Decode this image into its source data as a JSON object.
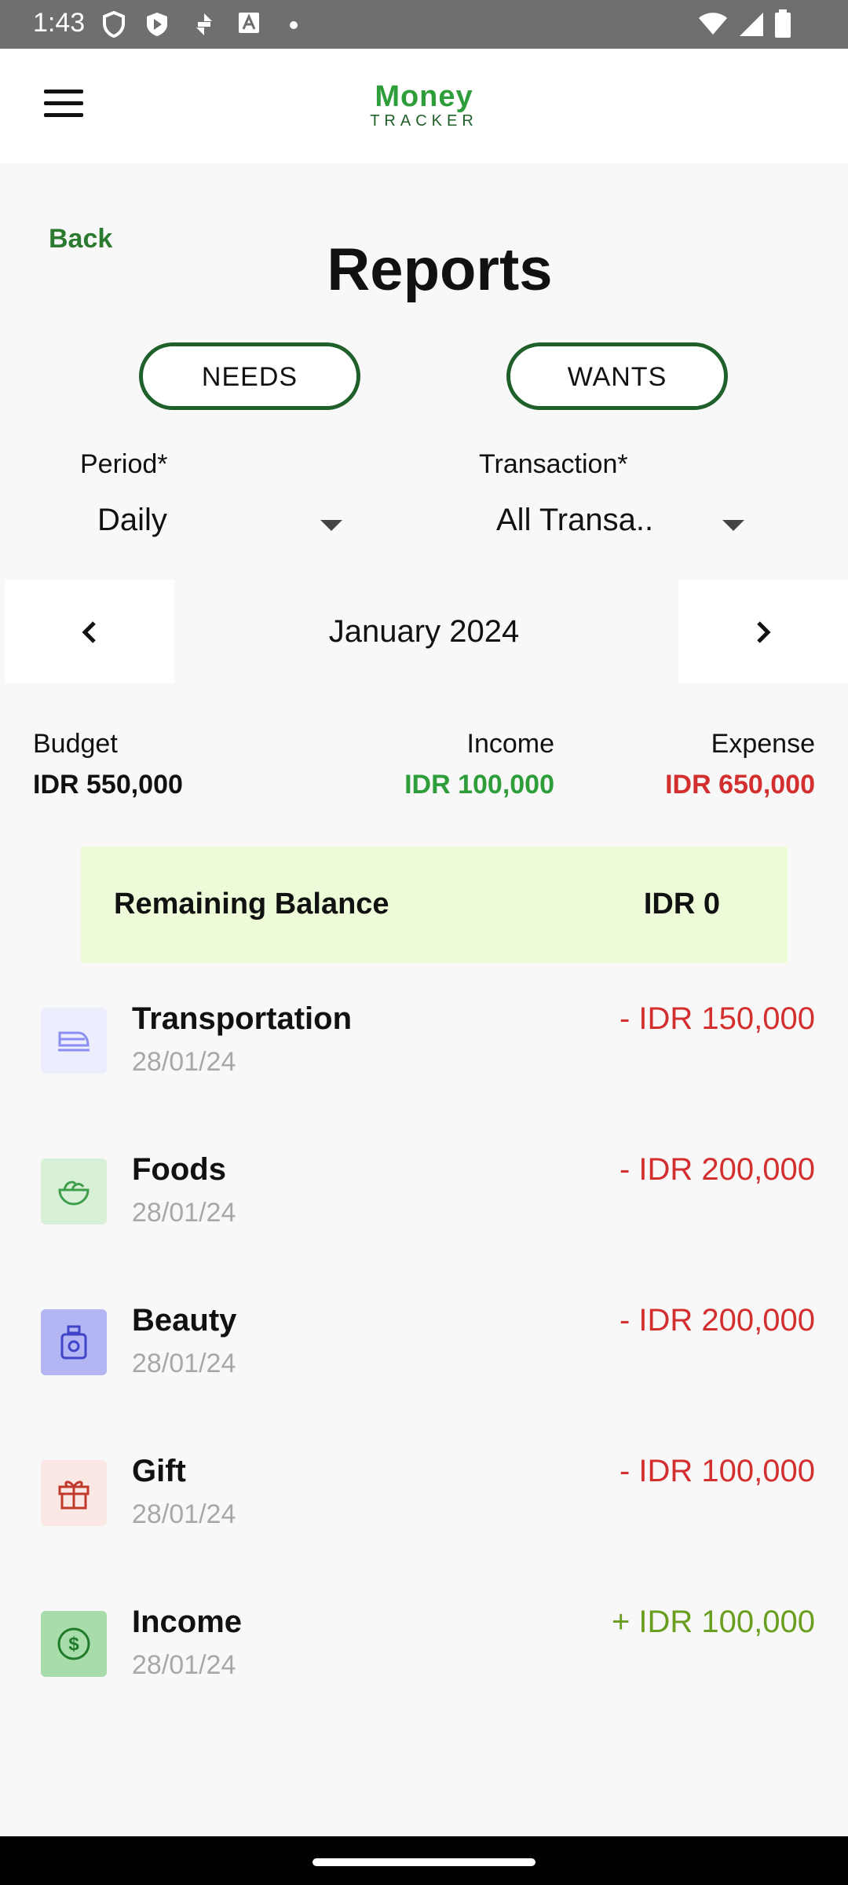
{
  "status_bar": {
    "time": "1:43"
  },
  "app": {
    "logo_line1": "Money",
    "logo_line2": "TRACKER"
  },
  "page": {
    "back_label": "Back",
    "title": "Reports"
  },
  "toggles": {
    "needs": "NEEDS",
    "wants": "WANTS"
  },
  "filters": {
    "period_label": "Period*",
    "period_value": "Daily",
    "transaction_label": "Transaction*",
    "transaction_value": "All Transa.."
  },
  "month_nav": {
    "current": "January 2024"
  },
  "summary": {
    "budget_label": "Budget",
    "budget_value": "IDR 550,000",
    "income_label": "Income",
    "income_value": "IDR 100,000",
    "expense_label": "Expense",
    "expense_value": "IDR 650,000"
  },
  "remaining": {
    "label": "Remaining Balance",
    "value": "IDR 0"
  },
  "transactions": [
    {
      "name": "Transportation",
      "date": "28/01/24",
      "amount": "- IDR 150,000",
      "icon": "train-icon"
    },
    {
      "name": "Foods",
      "date": "28/01/24",
      "amount": "- IDR 200,000",
      "icon": "food-bowl-icon"
    },
    {
      "name": "Beauty",
      "date": "28/01/24",
      "amount": "- IDR 200,000",
      "icon": "perfume-icon"
    },
    {
      "name": "Gift",
      "date": "28/01/24",
      "amount": "- IDR 100,000",
      "icon": "gift-icon"
    },
    {
      "name": "Income",
      "date": "28/01/24",
      "amount": "+ IDR 100,000",
      "icon": "dollar-icon"
    }
  ],
  "colors": {
    "brand_green": "#2e9e3a",
    "dark_green": "#1f5f2a",
    "income_green": "#2e9e3a",
    "expense_red": "#d32f2f",
    "income_item_green": "#6a9e1f",
    "remaining_bg": "#edfbd8"
  }
}
